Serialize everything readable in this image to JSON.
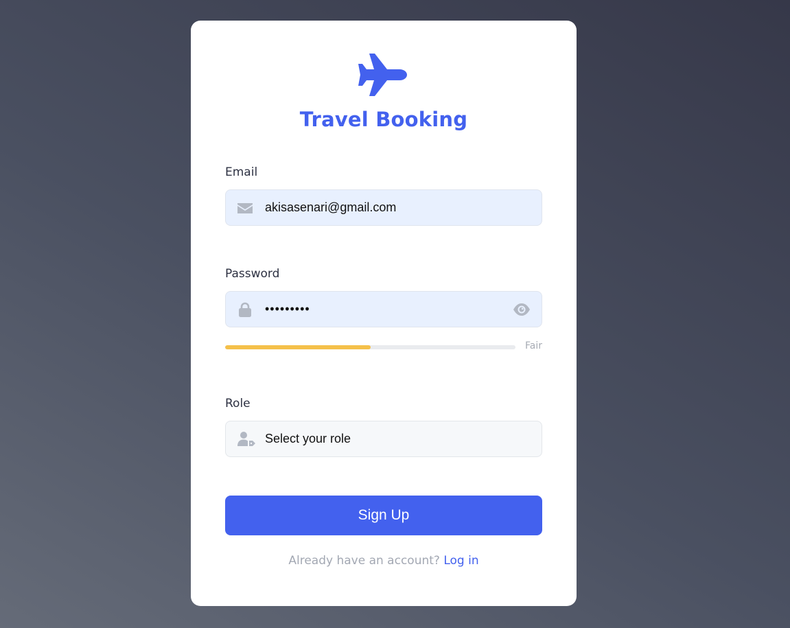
{
  "app": {
    "title": "Travel Booking",
    "brand_color": "#4361ee",
    "logo_icon": "airplane-icon"
  },
  "email": {
    "label": "Email",
    "value": "akisasenari@gmail.com",
    "icon": "envelope-icon"
  },
  "password": {
    "label": "Password",
    "value": "•••••••••",
    "icon": "lock-icon",
    "toggle_icon": "eye-icon",
    "strength": {
      "label": "Fair",
      "level": 0.5,
      "color": "#f5c04a"
    }
  },
  "role": {
    "label": "Role",
    "value": "Select your role",
    "icon": "user-tag-icon"
  },
  "actions": {
    "signup_label": "Sign Up",
    "login_prompt": "Already have an account?",
    "login_link": "Log in"
  }
}
